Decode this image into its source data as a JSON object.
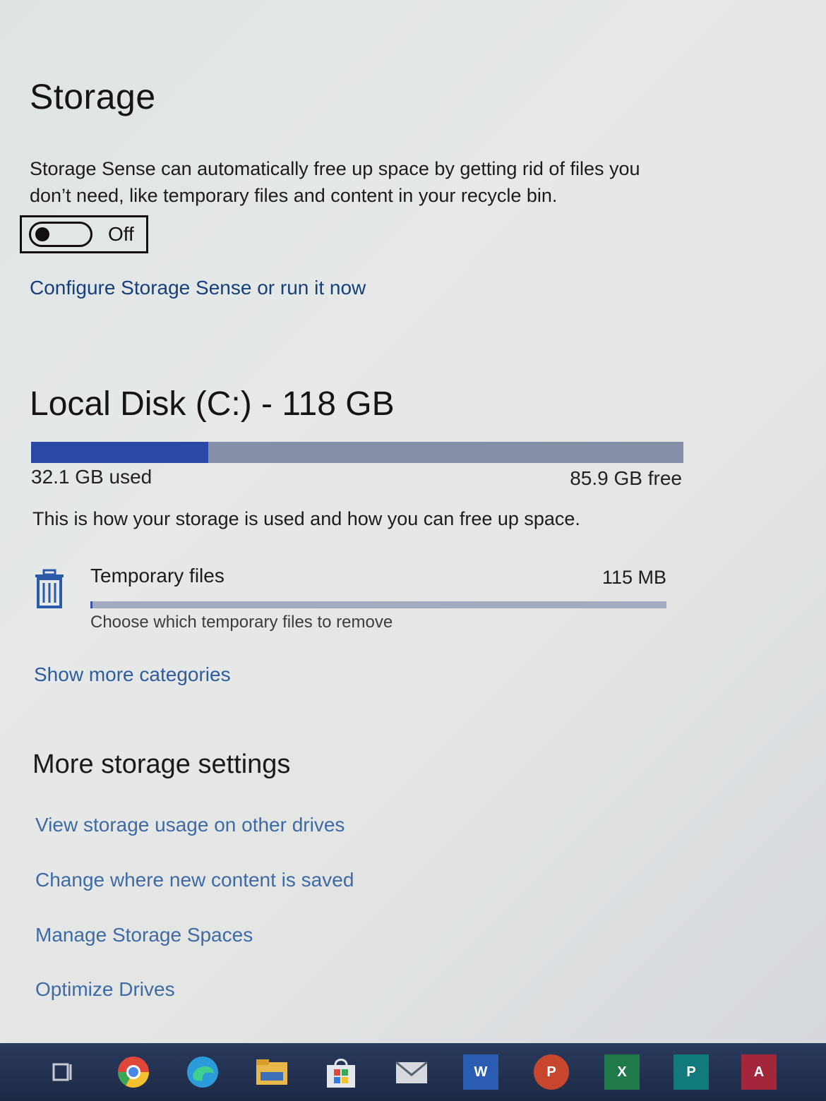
{
  "storage": {
    "title": "Storage",
    "description": "Storage Sense can automatically free up space by getting rid of files you don’t need, like temporary files and content in your recycle bin.",
    "toggle_state": "Off",
    "configure_link": "Configure Storage Sense or run it now"
  },
  "disk": {
    "title": "Local Disk (C:) - 118 GB",
    "used_label": "32.1 GB used",
    "free_label": "85.9 GB free",
    "used_fraction": 0.272,
    "info_text": "This is how your storage is used and how you can free up space."
  },
  "categories": [
    {
      "name": "Temporary files",
      "size": "115 MB",
      "description": "Choose which temporary files to remove",
      "icon": "trash-icon",
      "fill_fraction": 0.0
    }
  ],
  "show_more_link": "Show more categories",
  "more_settings": {
    "title": "More storage settings",
    "links": [
      "View storage usage on other drives",
      "Change where new content is saved",
      "Manage Storage Spaces",
      "Optimize Drives"
    ]
  },
  "taskbar": {
    "items": [
      {
        "name": "task-view-icon"
      },
      {
        "name": "chrome-icon"
      },
      {
        "name": "edge-icon"
      },
      {
        "name": "file-explorer-icon"
      },
      {
        "name": "store-icon"
      },
      {
        "name": "mail-icon"
      },
      {
        "name": "word-icon",
        "letter": "W"
      },
      {
        "name": "powerpoint-icon",
        "letter": "P"
      },
      {
        "name": "excel-icon",
        "letter": "X"
      },
      {
        "name": "publisher-icon",
        "letter": "P"
      },
      {
        "name": "access-icon",
        "letter": "A"
      }
    ]
  },
  "colors": {
    "link": "#1f4e8c",
    "disk_used": "#2a49a6",
    "disk_free": "#858fa8"
  }
}
